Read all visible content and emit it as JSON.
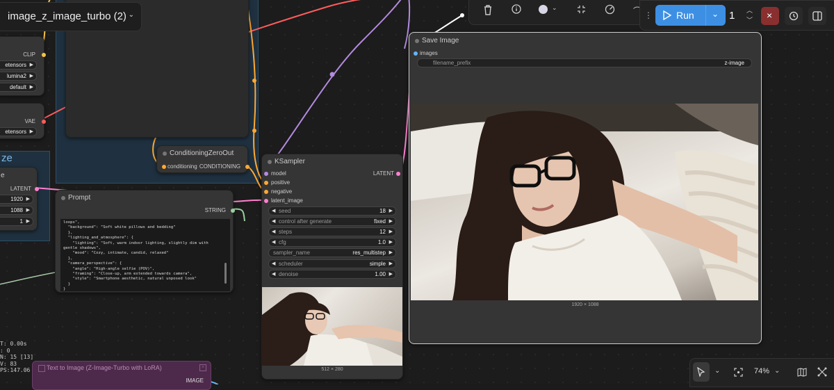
{
  "workflow_tab": {
    "title": "image_z_image_turbo (2)"
  },
  "toolbar": {
    "icons": [
      "trash-icon",
      "info-icon",
      "color-icon",
      "fit-icon",
      "bypass-icon"
    ]
  },
  "run_controls": {
    "run_label": "Run",
    "batch_count": "1"
  },
  "colors": {
    "accent": "#3d8fe3",
    "stop": "#8a2f2f",
    "clip_wire": "#f5c242",
    "vae_wire": "#ff5c5c",
    "model_wire": "#b48be0",
    "latent_wire": "#ff80cf",
    "cond_wire": "#ffa931"
  },
  "left_nodes": {
    "clip_label": "CLIP",
    "clip_widgets": [
      "etensors",
      "lumina2",
      "default"
    ],
    "vae_label": "VAE",
    "vae_widget": "etensors",
    "group_title_fragment": "ze",
    "latent_title_fragment": "e",
    "latent_label": "LATENT",
    "width": "1920",
    "height": "1088",
    "batch": "1"
  },
  "conditioning_node": {
    "title": "ConditioningZeroOut",
    "input": "conditioning",
    "output": "CONDITIONING"
  },
  "prompt_node": {
    "title": "Prompt",
    "output": "STRING",
    "text": "loops\", \n  \"background\": \"Soft white pillows and bedding\"\n  },\n  \"lighting_and_atmosphere\": {\n    \"lighting\": \"Soft, warm indoor lighting, slightly dim with\ngentle shadows\",\n    \"mood\": \"Cozy, intimate, candid, relaxed\"\n  },\n  \"camera_perspective\": {\n    \"angle\": \"High-angle selfie (POV)\",\n    \"framing\": \"Close-up, arm extended towards camera\",\n    \"style\": \"Smartphone aesthetic, natural unposed look\"\n  }\n}"
  },
  "ksampler": {
    "title": "KSampler",
    "inputs": [
      "model",
      "positive",
      "negative",
      "latent_image"
    ],
    "output": "LATENT",
    "widgets": [
      {
        "label": "seed",
        "value": "18"
      },
      {
        "label": "control after generate",
        "value": "fixed"
      },
      {
        "label": "steps",
        "value": "12"
      },
      {
        "label": "cfg",
        "value": "1.0"
      },
      {
        "label": "sampler_name",
        "value": "res_multistep"
      },
      {
        "label": "scheduler",
        "value": "simple"
      },
      {
        "label": "denoise",
        "value": "1.00"
      }
    ],
    "preview_size": "512 × 280"
  },
  "save_image": {
    "title": "Save Image",
    "input": "images",
    "filename_label": "filename_prefix",
    "filename_value": "z-image",
    "image_size": "1920 × 1088"
  },
  "stats": [
    "T: 0.00s",
    ": 0",
    "N: 15 [13]",
    "V: 83",
    "PS:147.06"
  ],
  "subgraph_node": {
    "title": "Text to Image (Z-Image-Turbo with LoRA)",
    "output": "IMAGE"
  },
  "bottom_bar": {
    "zoom": "74%"
  }
}
